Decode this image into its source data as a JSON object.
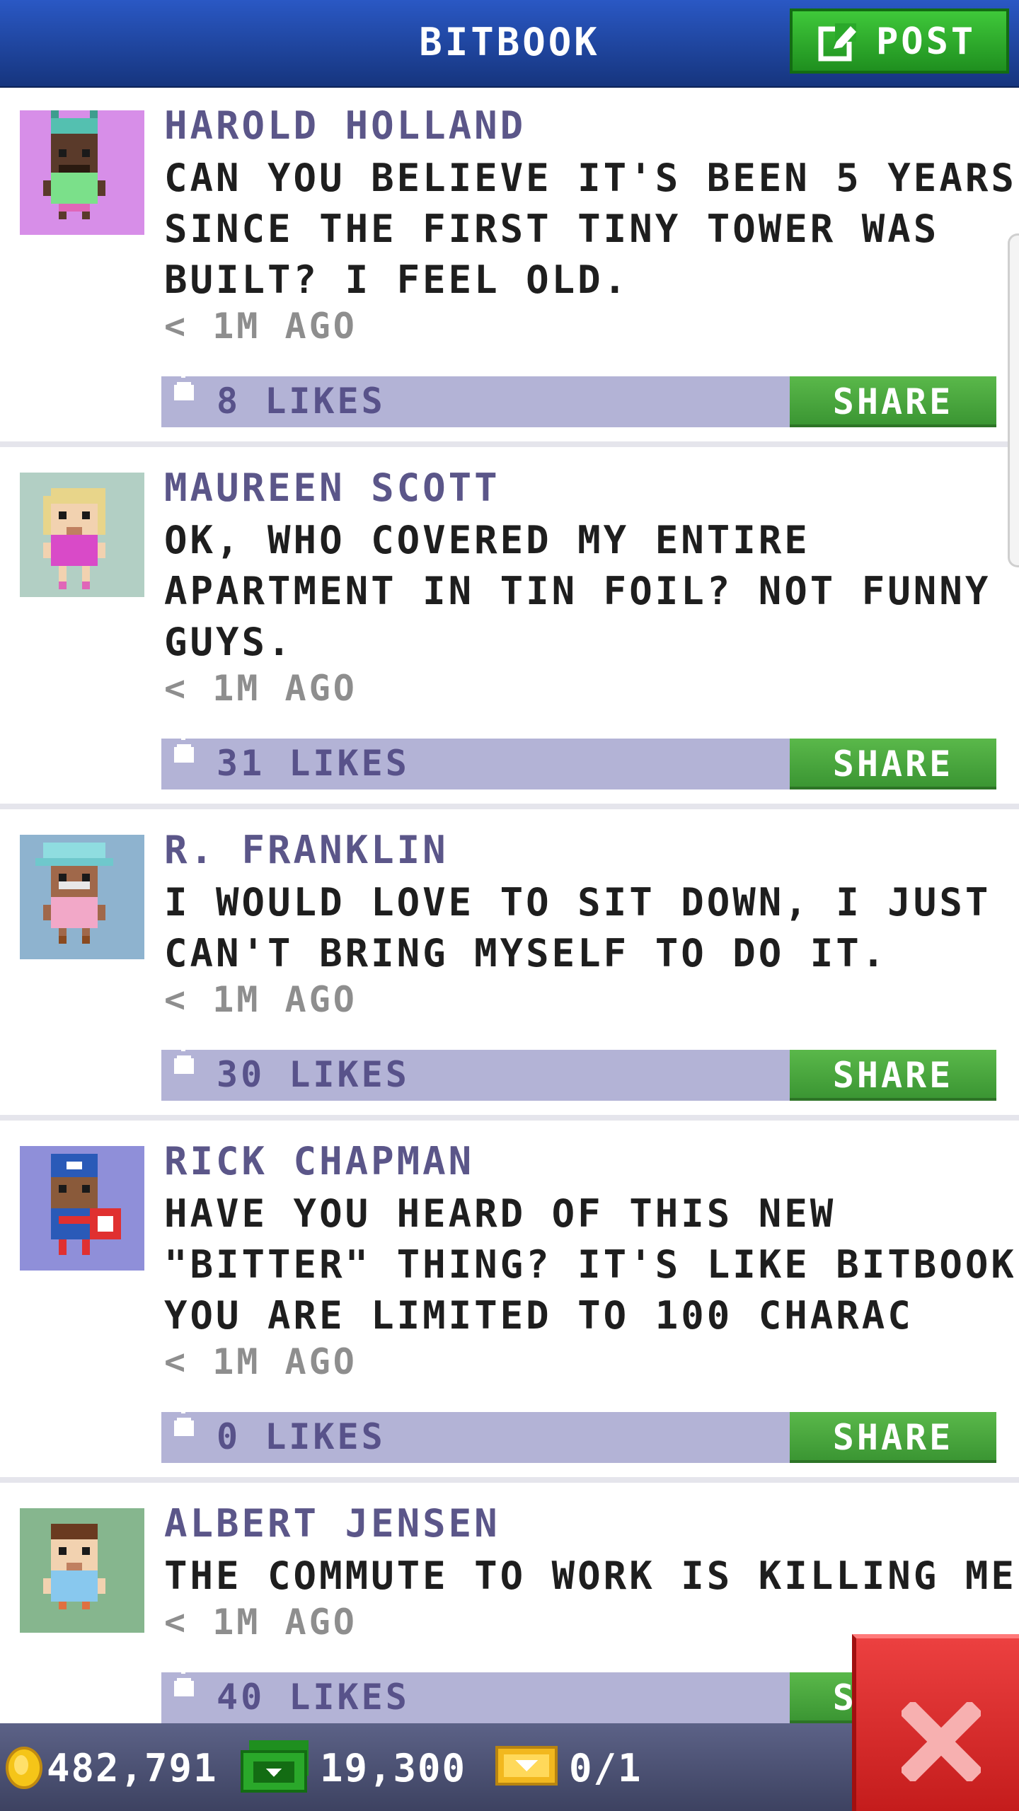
{
  "header": {
    "title": "BITBOOK",
    "post_label": "POST"
  },
  "feed": {
    "share_label": "SHARE",
    "posts": [
      {
        "author": "HAROLD HOLLAND",
        "lines": [
          "CAN YOU BELIEVE IT'S BEEN 5 YEARS",
          "SINCE THE FIRST TINY TOWER WAS",
          "BUILT? I FEEL OLD."
        ],
        "time": "< 1M AGO",
        "likes": "8 LIKES",
        "avatar_bg": "#d78ee8"
      },
      {
        "author": "MAUREEN SCOTT",
        "lines": [
          "OK, WHO COVERED MY ENTIRE",
          "APARTMENT IN TIN FOIL? NOT FUNNY",
          "GUYS."
        ],
        "time": "< 1M AGO",
        "likes": "31 LIKES",
        "avatar_bg": "#b2cfc4"
      },
      {
        "author": "R. FRANKLIN",
        "lines": [
          "I WOULD LOVE TO SIT DOWN, I JUST",
          "CAN'T BRING MYSELF TO DO IT."
        ],
        "time": "< 1M AGO",
        "likes": "30 LIKES",
        "avatar_bg": "#8eb3cf"
      },
      {
        "author": "RICK CHAPMAN",
        "lines": [
          "HAVE YOU HEARD OF THIS NEW",
          "\"BITTER\" THING? IT'S LIKE BITBOOK BUT",
          "YOU ARE LIMITED TO 100 CHARAC"
        ],
        "time": "< 1M AGO",
        "likes": "0 LIKES",
        "avatar_bg": "#8f8fd9"
      },
      {
        "author": "ALBERT JENSEN",
        "lines": [
          "THE COMMUTE TO WORK IS KILLING ME :("
        ],
        "time": "< 1M AGO",
        "likes": "40 LIKES",
        "avatar_bg": "#86b68e"
      }
    ]
  },
  "status": {
    "coins": "482,791",
    "bux": "19,300",
    "tickets": "0/1"
  },
  "icons": {
    "post": "compose-icon",
    "like": "thumbs-up-icon",
    "coin": "coin-icon",
    "bux": "bux-icon",
    "ticket": "vip-ticket-icon",
    "close": "close-icon"
  },
  "colors": {
    "header": "#2a58c4",
    "accent_green": "#3fc83a",
    "likes_bar": "#b3b3d6",
    "author_text": "#5b5689",
    "close": "#e03030"
  }
}
